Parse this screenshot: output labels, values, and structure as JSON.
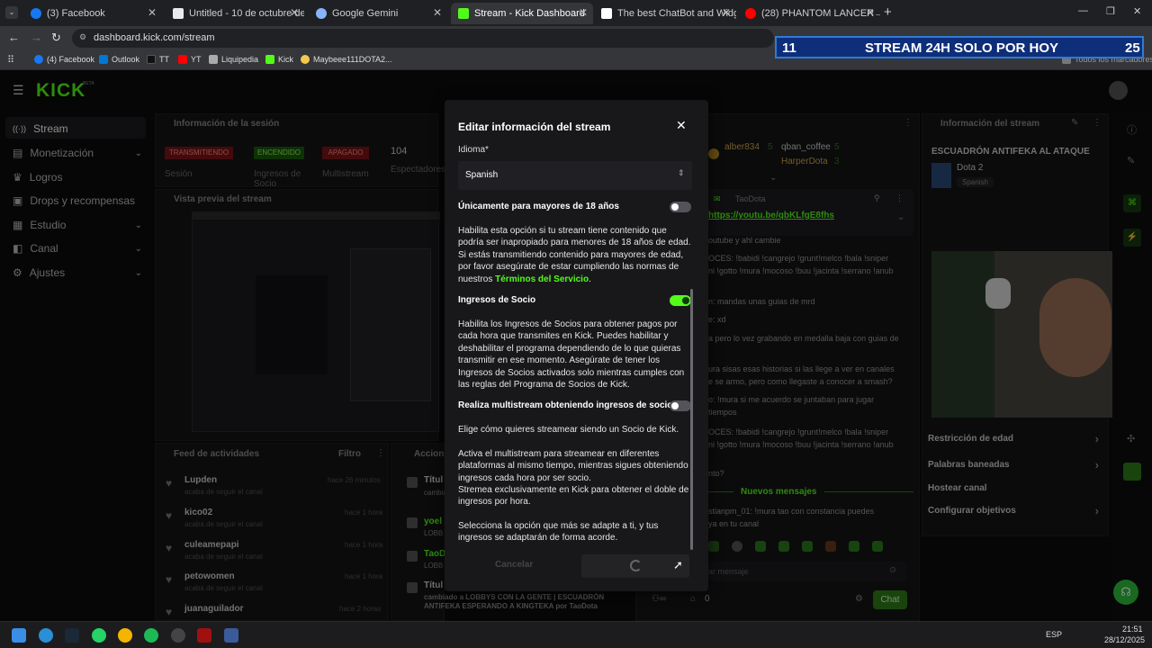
{
  "browser": {
    "tabs": [
      {
        "label": "(3) Facebook",
        "color": "#1877f2"
      },
      {
        "label": "Untitled - 10 de octubre de 20...",
        "color": "#e8eaed"
      },
      {
        "label": "Google Gemini",
        "color": "#8ab4f8"
      },
      {
        "label": "Stream - Kick Dashboard",
        "color": "#53fc18"
      },
      {
        "label": "The best ChatBot and Widgets",
        "color": "#ffffff"
      },
      {
        "label": "(28) PHANTOM LANCER→ No ...",
        "color": "#ff0000"
      }
    ],
    "url": "dashboard.kick.com/stream",
    "bookmarks": [
      "(4) Facebook",
      "Outlook",
      "TT",
      "YT",
      "Liquipedia",
      "Kick",
      "Maybeee111DOTA2..."
    ],
    "all_bookmarks": "Todos los marcadores"
  },
  "banner": {
    "left": "11",
    "text": "STREAM 24H SOLO POR HOY",
    "right": "25"
  },
  "kick": {
    "logo": "KICK",
    "beta": "BETA"
  },
  "nav": [
    {
      "label": "Stream",
      "icon": "signal-icon"
    },
    {
      "label": "Monetización",
      "chevron": true,
      "icon": "money-icon"
    },
    {
      "label": "Logros",
      "icon": "trophy-icon"
    },
    {
      "label": "Drops y recompensas",
      "icon": "gift-icon"
    },
    {
      "label": "Estudio",
      "chevron": true,
      "icon": "studio-icon"
    },
    {
      "label": "Canal",
      "chevron": true,
      "icon": "channel-icon"
    },
    {
      "label": "Ajustes",
      "chevron": true,
      "icon": "gear-icon"
    }
  ],
  "session": {
    "title": "Información de la sesión",
    "status": [
      {
        "badge": "TRANSMITIENDO",
        "label": "Sesión",
        "color": "#d42a2a"
      },
      {
        "badge": "ENCENDIDO",
        "label": "Ingresos de Socio",
        "color": "#2e9e0e"
      },
      {
        "badge": "APAGADO",
        "label": "Multistream",
        "color": "#d42a2a"
      },
      {
        "badge": "104",
        "label": "Espectadores",
        "color": "none"
      }
    ]
  },
  "preview": {
    "title": "Vista previa del stream"
  },
  "feed": {
    "title": "Feed de actividades",
    "filter": "Filtro",
    "items": [
      {
        "name": "Lupden",
        "sub": "acaba de seguir el canal",
        "time": "hace 26 minutos"
      },
      {
        "name": "kico02",
        "sub": "acaba de seguir el canal",
        "time": "hace 1 hora"
      },
      {
        "name": "culeamepapi",
        "sub": "acaba de seguir el canal",
        "time": "hace 1 hora"
      },
      {
        "name": "petowomen",
        "sub": "acaba de seguir el canal",
        "time": "hace 1 hora"
      },
      {
        "name": "juanaguilador",
        "sub": "acaba de seguir el canal",
        "time": "hace 2 horas"
      }
    ]
  },
  "actions": {
    "title": "Accion",
    "items": [
      "Títul",
      "yoel",
      "TaoD",
      "Títul"
    ],
    "subs": [
      "cambia",
      "LOBB",
      "LOBB",
      ""
    ],
    "last_line": "cambiado a LOBBYS CON LA GENTE | ESCUADRÓN ANTIFEKA ESPERANDO A KINGTEKA por TaoDota"
  },
  "chat": {
    "top_users": [
      {
        "name": "alber834",
        "n": "5"
      },
      {
        "name": "qban_coffee",
        "n": "5"
      },
      {
        "name": "HarperDota",
        "n": "3"
      }
    ],
    "pinned_user": "TaoDota",
    "pinned_link": "https://youtu.be/qbKLfgE8fhs",
    "lines": [
      "outube y ahl cambie",
      "OCES: !babidi !cangrejo !grunt!melco !bala !sniper",
      "ni !gotto !mura !mocoso !buu !jacinta !serrano !anub",
      "n: mandas unas guias de mrd",
      "e: xd",
      "a pero lo vez grabando en medalla baja con guias de",
      "ura sisas esas historias si las llege a ver en canales",
      "e se armo, pero como llegaste a conocer a smash?",
      "o: !mura si me acuerdo se juntaban para jugar",
      "tiempos",
      "OCES: !babidi !cangrejo !grunt!melco !bala !sniper",
      "ni !gotto !mura !mocoso !buu !jacinta !serrano !anub",
      "nto?"
    ],
    "new_messages": "Nuevos mensajes",
    "last_msg_1": "stianpm_01: !mura tao con constancia puedes",
    "last_msg_2": "ya en tu canal",
    "input_placeholder": "ar mensaje",
    "count": "0",
    "send": "Chat"
  },
  "info": {
    "title": "Información del stream",
    "stream_title": "ESCUADRÓN ANTIFEKA AL ATAQUE",
    "category": "Dota 2",
    "language": "Spanish",
    "settings": [
      {
        "label": "Restricción de edad",
        "chevron": true
      },
      {
        "label": "Palabras baneadas",
        "chevron": true
      },
      {
        "label": "Hostear canal",
        "chevron": false
      },
      {
        "label": "Configurar objetivos",
        "chevron": true
      }
    ]
  },
  "modal": {
    "title": "Editar información del stream",
    "language_label": "Idioma*",
    "language_value": "Spanish",
    "mature_label": "Únicamente para mayores de 18 años",
    "mature_on": false,
    "mature_desc": "Habilita esta opción si tu stream tiene contenido que podría ser inapropiado para menores de 18 años de edad. Si estás transmitiendo contenido para mayores de edad, por favor asegúrate de estar cumpliendo las normas de nuestros ",
    "terms_link": "Términos del Servicio",
    "terms_suffix": ".",
    "partner_label": "Ingresos de Socio",
    "partner_on": true,
    "partner_desc": "Habilita los Ingresos de Socios para obtener pagos por cada hora que transmites en Kick. Puedes habilitar y deshabilitar el programa dependiendo de lo que quieras transmitir en ese momento. Asegúrate de tener los Ingresos de Socios activados solo mientras cumples con las reglas del Programa de Socios de Kick.",
    "multistream_label": "Realiza multistream obteniendo ingresos de socio",
    "multistream_on": false,
    "ms_p1": "Elige cómo quieres streamear siendo un Socio de Kick.",
    "ms_p2": "Activa el multistream para streamear en diferentes plataformas al mismo tiempo, mientras sigues obteniendo ingresos cada hora por ser socio.",
    "ms_p3": "Stremea exclusivamente en Kick para obtener el doble de ingresos por hora.",
    "ms_p4": "Selecciona la opción que más se adapte a ti, y tus ingresos se adaptarán de forma acorde.",
    "cancel": "Cancelar"
  },
  "clock": {
    "time": "21:51",
    "date": "28/12/2025",
    "lang": "ESP"
  },
  "colors": {
    "kick_green": "#53fc18",
    "bg": "#0b0b0c",
    "panel": "#141416",
    "modal": "#18181b"
  }
}
